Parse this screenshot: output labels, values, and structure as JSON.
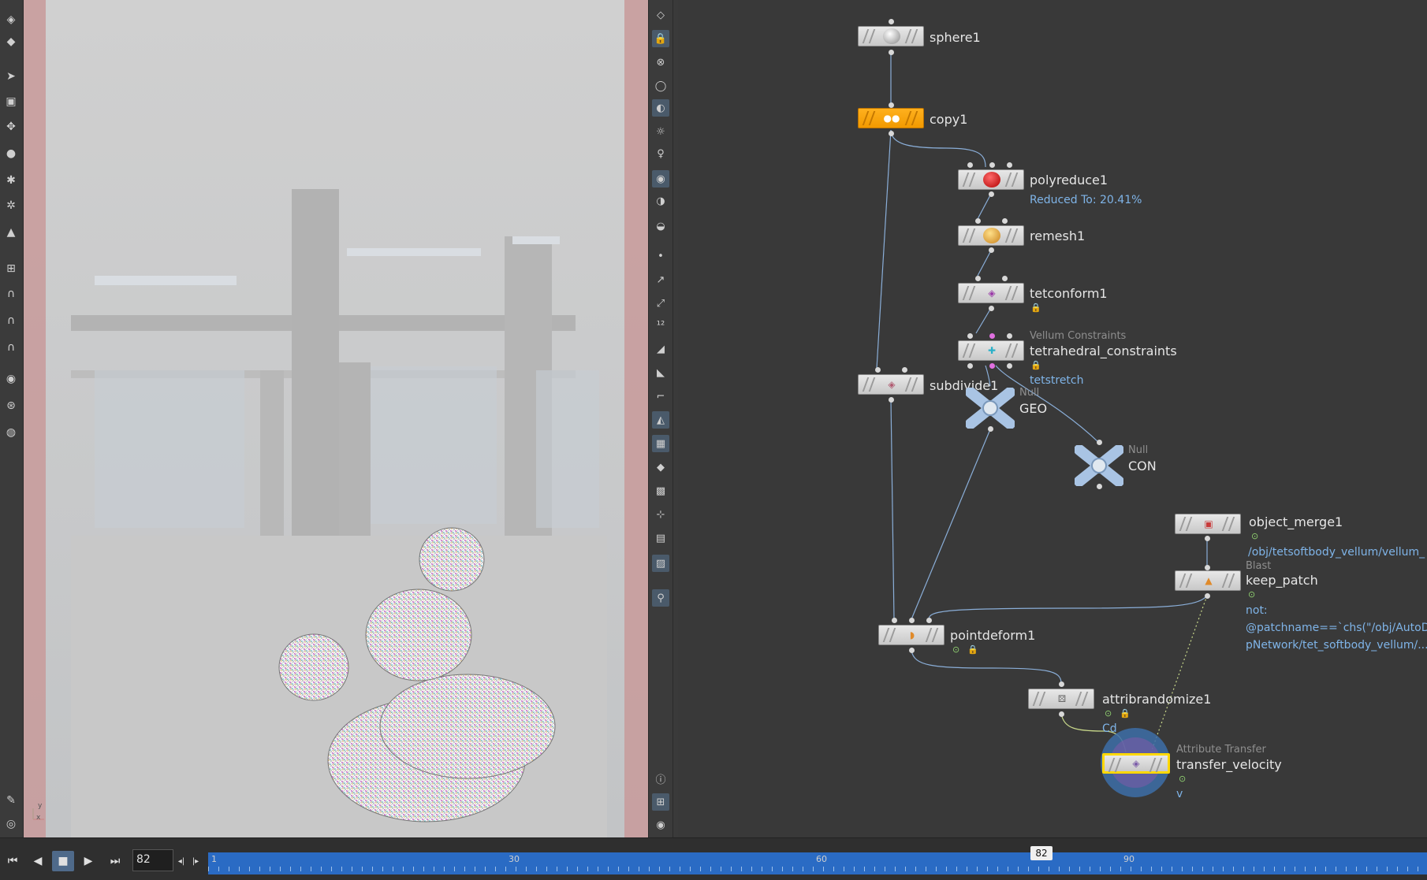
{
  "viewport": {
    "axis_labels": [
      "x",
      "y"
    ]
  },
  "network": {
    "nodes": {
      "sphere1": {
        "label": "sphere1"
      },
      "copy1": {
        "label": "copy1"
      },
      "polyreduce1": {
        "label": "polyreduce1",
        "info": "Reduced To: 20.41%"
      },
      "remesh1": {
        "label": "remesh1"
      },
      "tetconform1": {
        "label": "tetconform1"
      },
      "tetrahedral_constraints": {
        "type": "Vellum Constraints",
        "label": "tetrahedral_constraints",
        "info": "tetstretch"
      },
      "subdivide1": {
        "label": "subdivide1"
      },
      "geo": {
        "type": "Null",
        "label": "GEO"
      },
      "con": {
        "type": "Null",
        "label": "CON"
      },
      "object_merge1": {
        "label": "object_merge1",
        "info": "/obj/tetsoftbody_vellum/vellum_"
      },
      "keep_patch": {
        "type": "Blast",
        "label": "keep_patch",
        "info_lines": [
          "not:",
          "@patchname==`chs(\"/obj/AutoDo",
          "pNetwork/tet_softbody_vellum/..."
        ]
      },
      "pointdeform1": {
        "label": "pointdeform1"
      },
      "attribrandomize1": {
        "label": "attribrandomize1",
        "info": "Cd"
      },
      "transfer_velocity": {
        "type": "Attribute Transfer",
        "label": "transfer_velocity",
        "info": "v"
      }
    }
  },
  "timeline": {
    "frame_value": "82",
    "start": 1,
    "end": 96,
    "current": 82,
    "current_label": "82",
    "tick_labels": [
      "1",
      "30",
      "60",
      "90"
    ],
    "buttons": [
      "jump-start",
      "step-back",
      "stop",
      "play",
      "jump-end"
    ]
  },
  "colors": {
    "accent_blue": "#2a6bc4",
    "node_selected": "#f29a00",
    "info_text": "#7fb4e8"
  }
}
